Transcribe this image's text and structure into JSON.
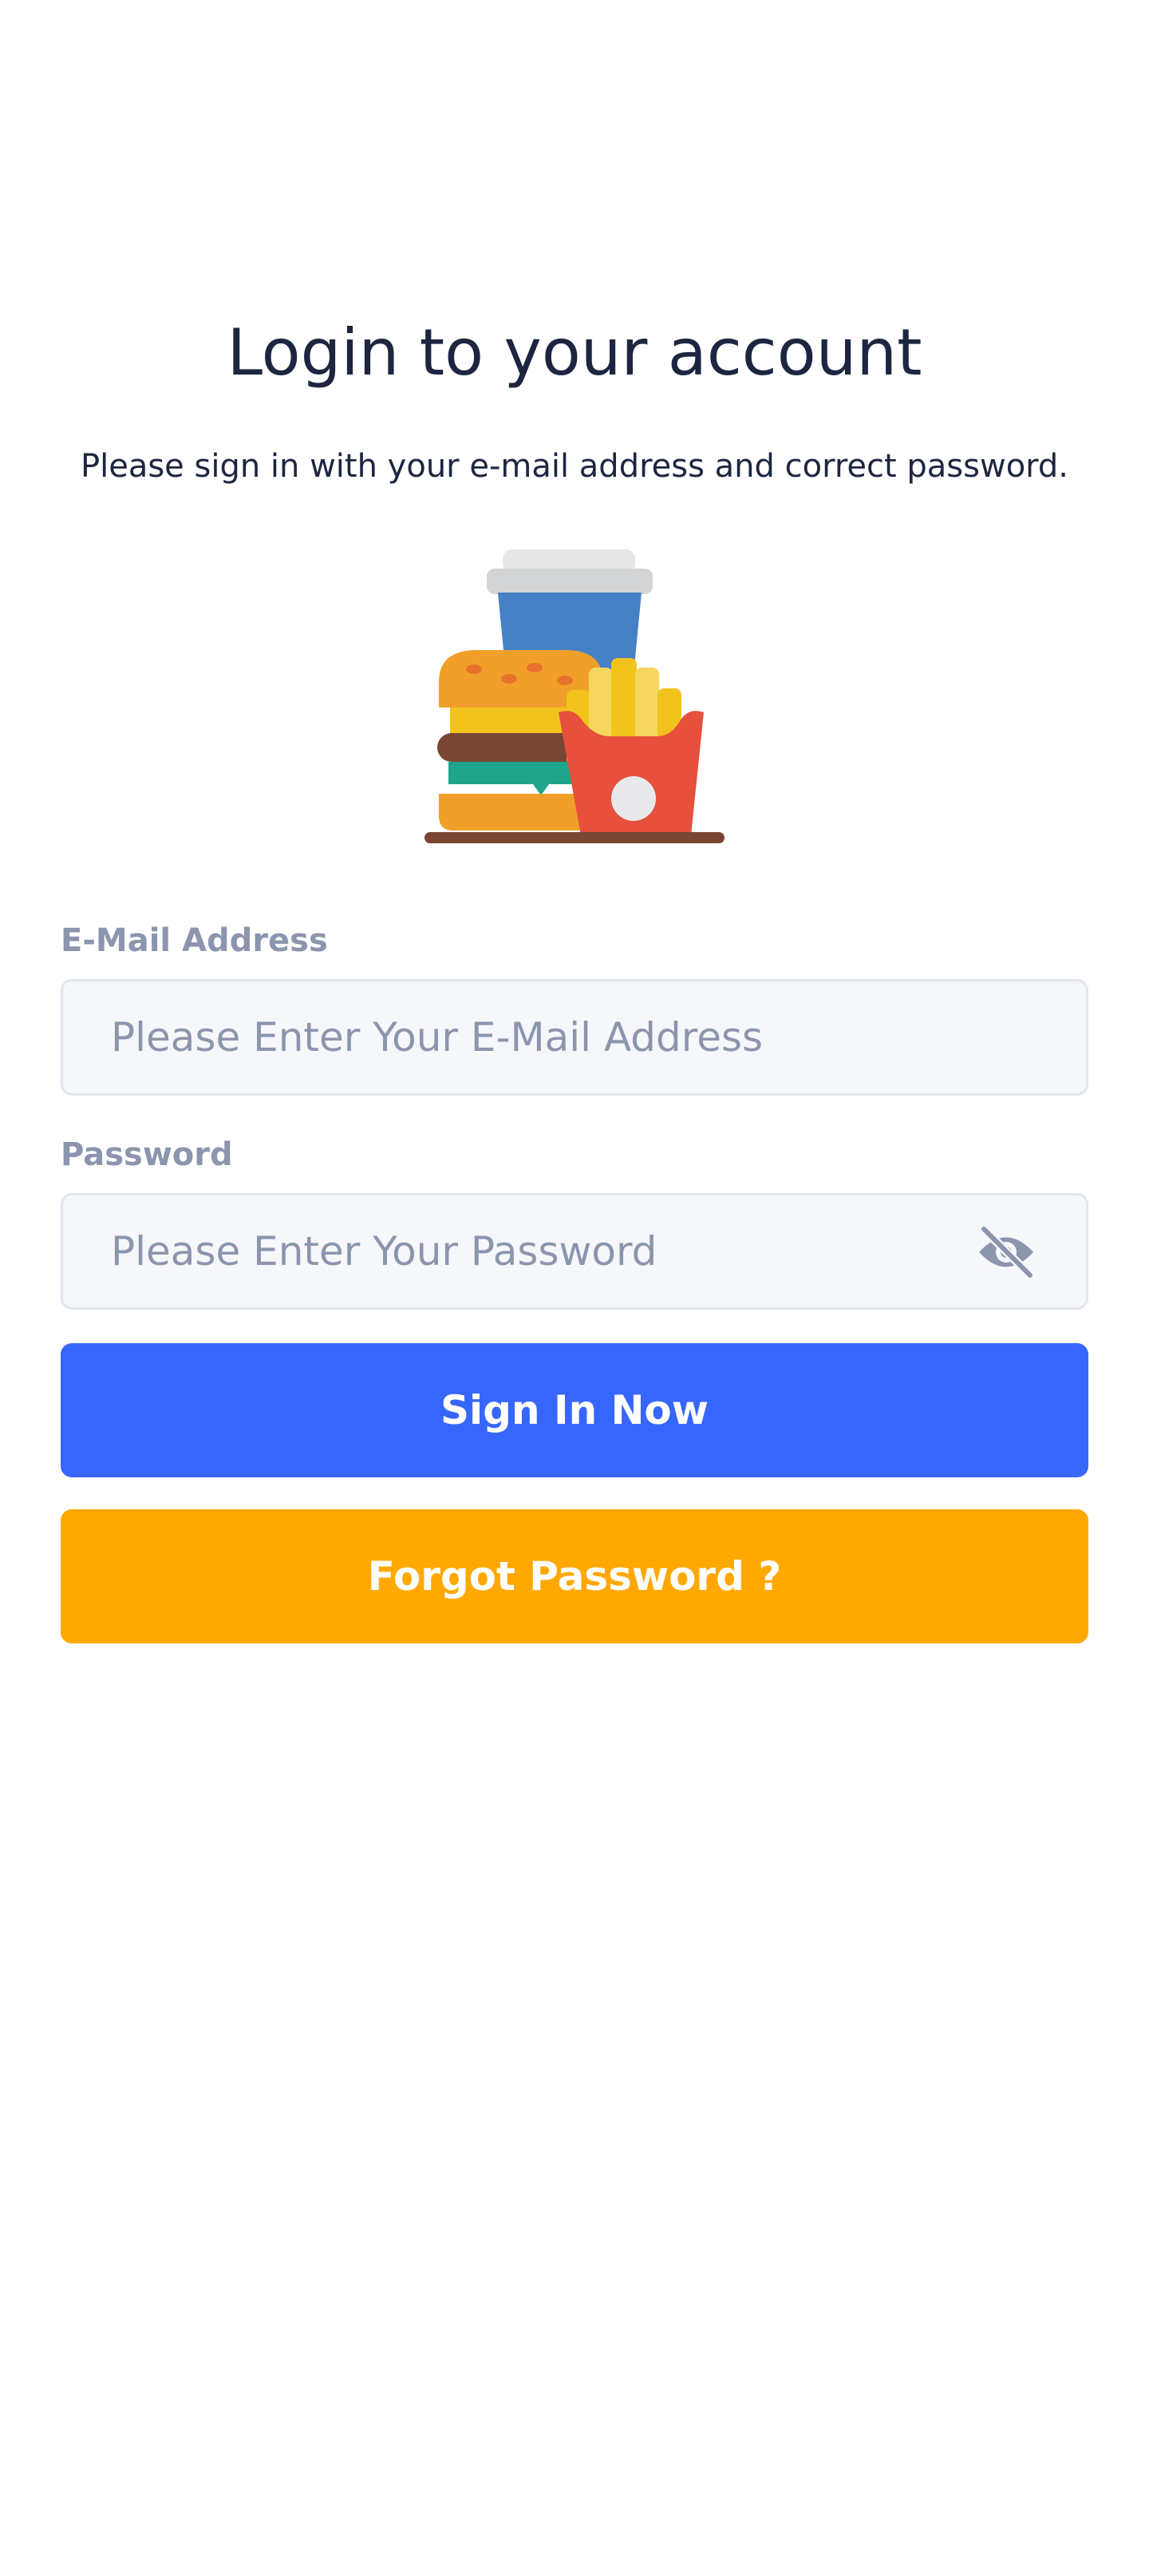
{
  "header": {
    "title": "Login to your account",
    "subtitle": "Please sign in with your e-mail address and correct password."
  },
  "illustration": {
    "icon": "fast-food-illustration-icon"
  },
  "form": {
    "email": {
      "label": "E-Mail Address",
      "value": "",
      "placeholder": "Please Enter Your E-Mail Address"
    },
    "password": {
      "label": "Password",
      "value": "",
      "placeholder": "Please Enter Your Password",
      "toggle_icon": "eye-off-icon"
    }
  },
  "actions": {
    "sign_in_label": "Sign In Now",
    "forgot_label": "Forgot Password ?"
  },
  "colors": {
    "primary": "#3766fd",
    "warning": "#ffa800",
    "label": "#8b95ad",
    "title": "#1c2640",
    "input_bg": "#f6f7fb"
  }
}
